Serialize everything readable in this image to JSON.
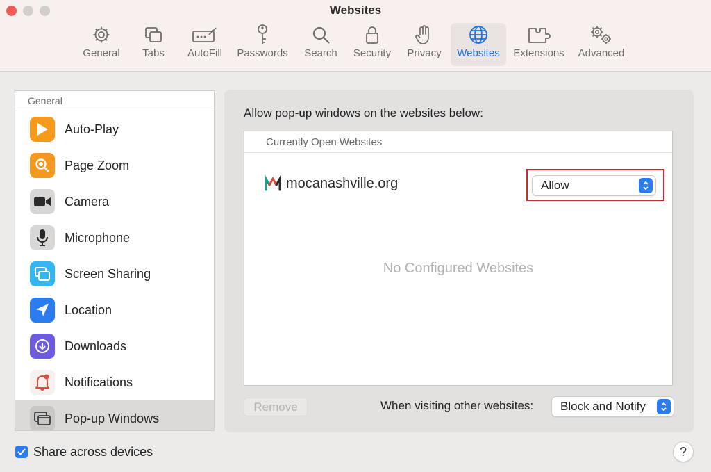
{
  "window": {
    "title": "Websites"
  },
  "toolbar": {
    "tabs": [
      {
        "label": "General",
        "icon": "gear-icon"
      },
      {
        "label": "Tabs",
        "icon": "tabs-icon"
      },
      {
        "label": "AutoFill",
        "icon": "autofill-icon"
      },
      {
        "label": "Passwords",
        "icon": "key-icon"
      },
      {
        "label": "Search",
        "icon": "search-icon"
      },
      {
        "label": "Security",
        "icon": "lock-icon"
      },
      {
        "label": "Privacy",
        "icon": "hand-icon"
      },
      {
        "label": "Websites",
        "icon": "globe-icon",
        "active": true
      },
      {
        "label": "Extensions",
        "icon": "puzzle-icon"
      },
      {
        "label": "Advanced",
        "icon": "gears-icon"
      }
    ]
  },
  "sidebar": {
    "section_title": "General",
    "items": [
      {
        "label": "Auto-Play",
        "icon": "play-icon"
      },
      {
        "label": "Page Zoom",
        "icon": "zoom-icon"
      },
      {
        "label": "Camera",
        "icon": "camera-icon"
      },
      {
        "label": "Microphone",
        "icon": "microphone-icon"
      },
      {
        "label": "Screen Sharing",
        "icon": "screen-sharing-icon"
      },
      {
        "label": "Location",
        "icon": "location-icon"
      },
      {
        "label": "Downloads",
        "icon": "download-icon"
      },
      {
        "label": "Notifications",
        "icon": "bell-icon"
      },
      {
        "label": "Pop-up Windows",
        "icon": "popup-windows-icon",
        "selected": true
      }
    ]
  },
  "main": {
    "title": "Allow pop-up windows on the websites below:",
    "list_header": "Currently Open Websites",
    "site": {
      "name": "mocanashville.org",
      "setting": "Allow"
    },
    "empty_text": "No Configured Websites",
    "remove_label": "Remove",
    "other_label": "When visiting other websites:",
    "other_value": "Block and Notify"
  },
  "footer": {
    "share_label": "Share across devices",
    "share_checked": true,
    "help_label": "?"
  },
  "colors": {
    "accent": "#2b7cf0",
    "active_tab_text": "#1a73e8",
    "highlight_border": "#cc2a2e",
    "close_button": "#ee5e57"
  }
}
